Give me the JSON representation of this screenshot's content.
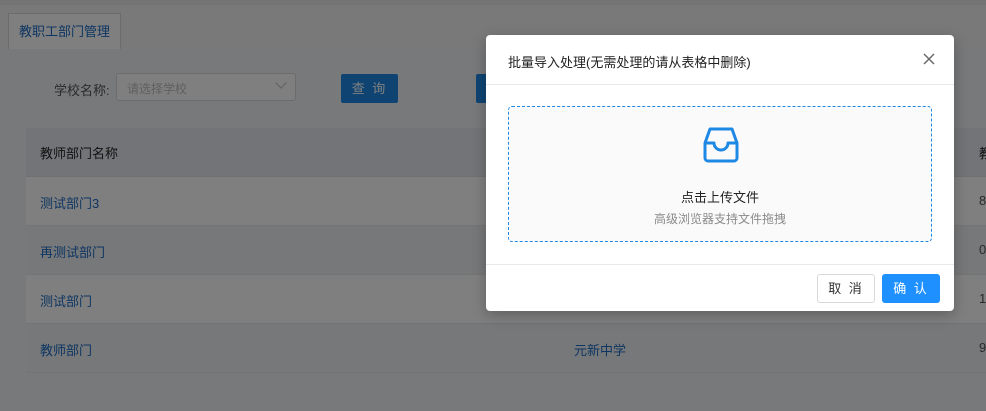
{
  "tabs": [
    {
      "label": "教职工部门管理"
    }
  ],
  "filter": {
    "school_label": "学校名称:",
    "school_placeholder": "请选择学校",
    "query_button": "查 询"
  },
  "table": {
    "headers": [
      "教师部门名称",
      "教"
    ],
    "rows": [
      {
        "name": "测试部门3",
        "school": "",
        "extra": "8"
      },
      {
        "name": "再测试部门",
        "school": "",
        "extra": "0"
      },
      {
        "name": "测试部门",
        "school": "",
        "extra": "1"
      },
      {
        "name": "教师部门",
        "school": "元新中学",
        "extra": "9"
      }
    ]
  },
  "modal": {
    "title": "批量导入处理(无需处理的请从表格中删除)",
    "close_icon": "close-icon",
    "upload": {
      "icon": "inbox-icon",
      "text": "点击上传文件",
      "hint": "高级浏览器支持文件拖拽"
    },
    "cancel_button": "取 消",
    "confirm_button": "确 认"
  },
  "colors": {
    "primary": "#1e88e5",
    "link": "#1b6bc4",
    "overlay": "rgba(0,0,0,0.5)"
  }
}
